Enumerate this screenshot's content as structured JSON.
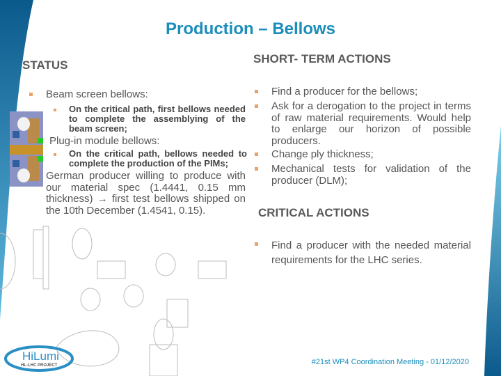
{
  "title": "Production – Bellows",
  "status": {
    "heading": "STATUS",
    "items": [
      {
        "label": "Beam screen bellows:",
        "sub": [
          "On the critical path, first bellows needed to complete the assemblying of the beam screen;"
        ]
      },
      {
        "label": "Plug-in module bellows:",
        "sub": [
          "On the critical path, bellows needed to complete the production of the PIMs;"
        ],
        "note": "German producer willing to produce with our material spec (1.4441, 0.15 mm thickness) → first test bellows shipped on the 10th December (1.4541, 0.15)."
      }
    ]
  },
  "short_term": {
    "heading": "SHORT- TERM ACTIONS",
    "items": [
      "Find a producer for the bellows;",
      "Ask for a derogation to the project in terms of raw material requirements. Would help to enlarge our horizon of possible producers.",
      "Change ply thickness;",
      "Mechanical tests for validation of the producer (DLM);"
    ]
  },
  "critical": {
    "heading": "CRITICAL ACTIONS",
    "items": [
      "Find a producer with the needed material requirements for the LHC series."
    ]
  },
  "logo": {
    "main": "HiLumi",
    "sub": "HL-LHC PROJECT"
  },
  "footer": "#21st WP4 Coordination Meeting - 01/12/2020",
  "colors": {
    "accent": "#1a8dbb",
    "bullet": "#e8a36a",
    "text": "#595959"
  }
}
